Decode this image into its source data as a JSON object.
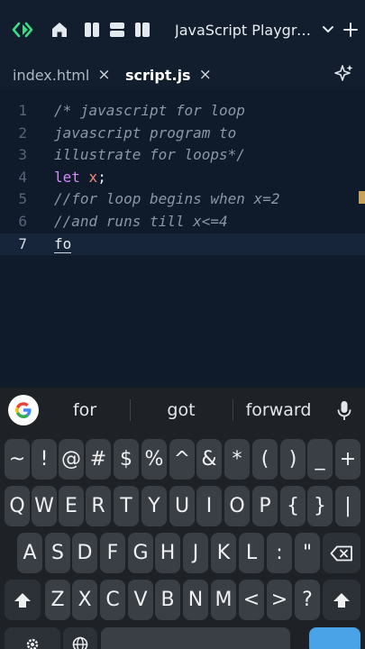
{
  "toolbar": {
    "project_title": "JavaScript Playgro...",
    "icons": [
      "code-logo-icon",
      "home-icon",
      "layout-split-vertical-icon",
      "layout-split-horizontal-icon",
      "layout-sidebar-icon",
      "chevron-down-icon",
      "plus-icon"
    ]
  },
  "tabs": [
    {
      "label": "index.html",
      "active": false
    },
    {
      "label": "script.js",
      "active": true
    }
  ],
  "tab_close_glyph": "×",
  "editor": {
    "lines": [
      {
        "num": "1",
        "text": "/* javascript for loop"
      },
      {
        "num": "2",
        "text": "javascript program to"
      },
      {
        "num": "3",
        "text": "illustrate for loops*/"
      },
      {
        "num": "4",
        "keyword": "let",
        "var": "x",
        "rest": ";"
      },
      {
        "num": "5",
        "text": "//for loop begins when x=2"
      },
      {
        "num": "6",
        "text": "//and runs till x<=4"
      },
      {
        "num": "7",
        "typed": "fo"
      }
    ]
  },
  "keyboard": {
    "suggestions": [
      "for",
      "got",
      "forward"
    ],
    "row_symbols": [
      "~",
      "!",
      "@",
      "#",
      "$",
      "%",
      "^",
      "&",
      "*",
      "(",
      ")",
      "_",
      "+"
    ],
    "row_q": [
      "Q",
      "W",
      "E",
      "R",
      "T",
      "Y",
      "U",
      "I",
      "O",
      "P",
      "{",
      "}",
      "|"
    ],
    "row_a": [
      "A",
      "S",
      "D",
      "F",
      "G",
      "H",
      "J",
      "K",
      "L",
      ":",
      "\""
    ],
    "row_z": [
      "Z",
      "X",
      "C",
      "V",
      "B",
      "N",
      "M",
      "<",
      ">",
      "?"
    ]
  },
  "colors": {
    "editor_bg": "#0f1a2a",
    "toolbar_bg": "#121d2d",
    "accent_green": "#3ddc84",
    "keyword": "#d38cf6",
    "variable": "#f08a7c",
    "comment": "#8b97a8",
    "keyboard_bg": "#1e2126",
    "key_bg": "#3a3f46"
  }
}
